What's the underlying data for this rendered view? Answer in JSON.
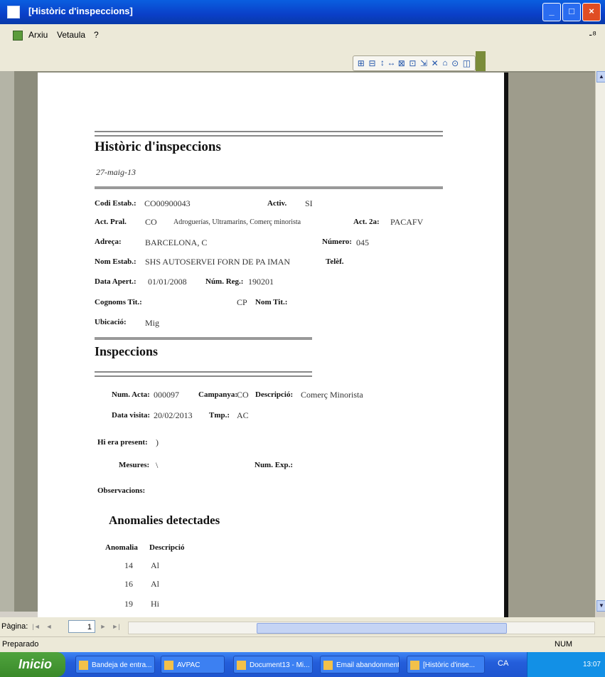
{
  "window": {
    "title": "[Històric d'inspeccions]",
    "min": "_",
    "max": "□",
    "close": "×"
  },
  "menu": {
    "items": [
      "Arxiu",
      "Vetaula",
      "?"
    ],
    "right_icon": "-⁸"
  },
  "toolbar": {
    "buttons": [
      "⊞",
      "⊟",
      "↕",
      "↔",
      "⊠",
      "⊡",
      "⇲",
      "✕",
      "⌂",
      "⊙",
      "◫"
    ]
  },
  "report": {
    "title": "Històric d'inspeccions",
    "date": "27-maig-13",
    "fields": {
      "codi_lbl": "Codi Estab.:",
      "codi_val": "CO00900043",
      "activ_lbl": "Activ.",
      "activ_val": "SI",
      "actpral_lbl": "Act. Pral.",
      "actpral_val": "CO",
      "actpral_desc": "Adroguerías, Ultramarins, Comerç minorista",
      "act2_lbl": "Act. 2a:",
      "act2_val": "PACAFV",
      "adreca_lbl": "Adreça:",
      "adreca_val": "BARCELONA, C",
      "numero_lbl": "Número:",
      "numero_val": "045",
      "nom_lbl": "Nom Estab.:",
      "nom_val": "SHS AUTOSERVEI FORN DE PA IMAN",
      "telf_lbl": "Telèf.",
      "data_lbl": "Data Apert.:",
      "data_val": "01/01/2008",
      "reg_lbl": "Núm. Reg.:",
      "reg_val": "190201",
      "cognoms_lbl": "Cognoms Tit.:",
      "cp_lbl": "CP",
      "nomtit_lbl": "Nom Tit.:",
      "ubicacio_lbl": "Ubicació:",
      "ubicacio_val": "Mig"
    },
    "inspeccions_title": "Inspeccions",
    "insp": {
      "acta_lbl": "Num. Acta:",
      "acta_val": "000097",
      "campanya_lbl": "Campanya:",
      "campanya_val": "CO",
      "descr_lbl": "Descripció:",
      "descr_val": "Comerç Minorista",
      "visita_lbl": "Data visita:",
      "visita_val": "20/02/2013",
      "tmp_lbl": "Tmp.:",
      "tmp_val": "AC",
      "present_lbl": "Hi era present:",
      "present_val": ")",
      "mesures_lbl": "Mesures:",
      "mesures_val": "\\",
      "exp_lbl": "Num. Exp.:",
      "obs_lbl": "Observacions:"
    },
    "anomalies_title": "Anomalies detectades",
    "anom_col1": "Anomalia",
    "anom_col2": "Descripció",
    "anomalies": [
      {
        "code": "14",
        "desc": "Al"
      },
      {
        "code": "16",
        "desc": "Al"
      },
      {
        "code": "19",
        "desc": "Hi"
      }
    ]
  },
  "nav": {
    "label": "Pàgina:",
    "page": "1",
    "first": "|◄",
    "prev": "◄",
    "next": "►",
    "last": "►|",
    "new": "►*"
  },
  "status": {
    "left": "Preparado",
    "right": "NUM"
  },
  "taskbar": {
    "start": "Inicio",
    "tasks": [
      "Bandeja de entra...",
      "AVPAC",
      "Document13 - Mi...",
      "Email abandonment...",
      "[Històric d'inse..."
    ],
    "lang": "CA",
    "clock": "13:07"
  },
  "colors": {
    "titlebar": "#0a5fe0",
    "taskbar": "#245edb",
    "start": "#3a8a2a"
  }
}
